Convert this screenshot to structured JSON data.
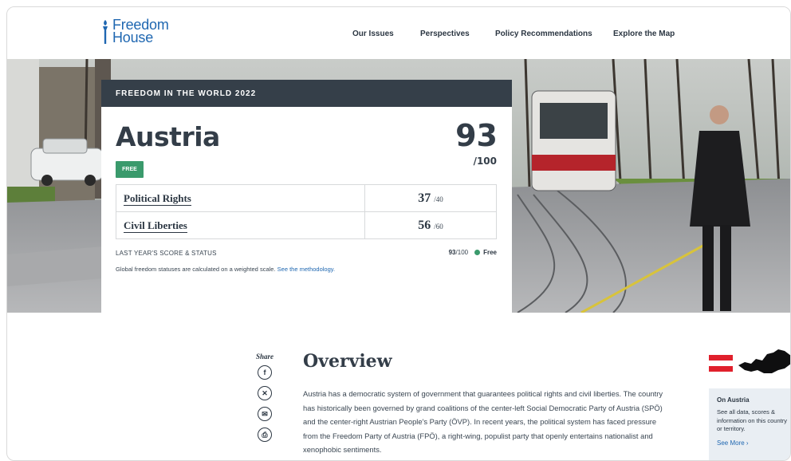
{
  "brand": {
    "line1": "Freedom",
    "line2": "House"
  },
  "nav": [
    {
      "label": "Our Issues"
    },
    {
      "label": "Perspectives"
    },
    {
      "label": "Policy Recommendations"
    },
    {
      "label": "Explore the Map"
    }
  ],
  "card": {
    "header": "FREEDOM IN THE WORLD 2022",
    "country": "Austria",
    "status_badge": "FREE",
    "total_score": "93",
    "total_denom": "/100",
    "categories": [
      {
        "label": "Political Rights",
        "score": "37",
        "max": "/40"
      },
      {
        "label": "Civil Liberties",
        "score": "56",
        "max": "/60"
      }
    ],
    "last_year_label": "LAST YEAR'S SCORE & STATUS",
    "last_year_score": "93",
    "last_year_denom": "/100",
    "last_year_status": "Free",
    "method_text": "Global freedom statuses are calculated on a weighted scale.",
    "method_link": "See the methodology."
  },
  "share": {
    "label": "Share",
    "buttons": [
      "facebook-icon",
      "x-icon",
      "email-icon",
      "print-icon"
    ]
  },
  "overview": {
    "title": "Overview",
    "text": "Austria has a democratic system of government that guarantees political rights and civil liberties. The country has historically been governed by grand coalitions of the center-left Social Democratic Party of Austria (SPÖ) and the center-right Austrian People's Party (ÖVP). In recent years, the political system has faced pressure from the Freedom Party of Austria (FPÖ), a right-wing, populist party that openly entertains nationalist and xenophobic sentiments."
  },
  "aside": {
    "title": "On Austria",
    "text": "See all data, scores & information on this country or territory.",
    "link": "See More"
  },
  "colors": {
    "brand_blue": "#1f67b1",
    "card_header": "#353f49",
    "free_green": "#3a9a6c",
    "flag_red": "#e0202c"
  }
}
